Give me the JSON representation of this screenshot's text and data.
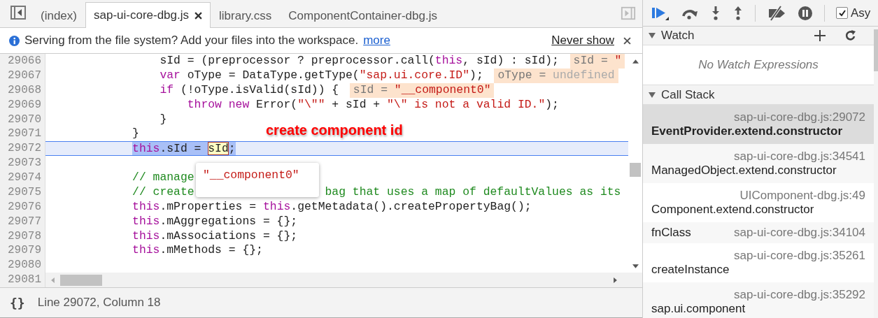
{
  "tabs": {
    "items": [
      {
        "label": "(index)",
        "selected": false,
        "closable": false
      },
      {
        "label": "sap-ui-core-dbg.js",
        "selected": true,
        "closable": true
      },
      {
        "label": "library.css",
        "selected": false,
        "closable": false
      },
      {
        "label": "ComponentContainer-dbg.js",
        "selected": false,
        "closable": false
      }
    ]
  },
  "infobar": {
    "message": "Serving from the file system? Add your files into the workspace.",
    "link": "more",
    "dismiss": "Never show"
  },
  "editor": {
    "lines": [
      {
        "number": "29066",
        "current": false,
        "tokens": [
          {
            "kind": "plain",
            "text": "                sId = (preprocessor ? preprocessor.call("
          },
          {
            "kind": "kw",
            "text": "this"
          },
          {
            "kind": "plain",
            "text": ", sId) : sId);"
          }
        ],
        "inline_value": [
          {
            "kind": "name",
            "text": "sId = "
          },
          {
            "kind": "str",
            "text": "\""
          }
        ]
      },
      {
        "number": "29067",
        "current": false,
        "tokens": [
          {
            "kind": "kw",
            "text": "                var"
          },
          {
            "kind": "plain",
            "text": " oType = DataType.getType("
          },
          {
            "kind": "str",
            "text": "\"sap.ui.core.ID\""
          },
          {
            "kind": "plain",
            "text": ");"
          }
        ],
        "inline_value": [
          {
            "kind": "name",
            "text": "oType = "
          },
          {
            "kind": "undef",
            "text": "undefined"
          }
        ]
      },
      {
        "number": "29068",
        "current": false,
        "tokens": [
          {
            "kind": "kw",
            "text": "                if"
          },
          {
            "kind": "plain",
            "text": " (!oType.isValid(sId)) {"
          }
        ],
        "inline_value": [
          {
            "kind": "name",
            "text": "sId = "
          },
          {
            "kind": "str",
            "text": "\"__component0\""
          }
        ]
      },
      {
        "number": "29069",
        "current": false,
        "tokens": [
          {
            "kind": "kw",
            "text": "                    throw new"
          },
          {
            "kind": "plain",
            "text": " Error("
          },
          {
            "kind": "str",
            "text": "\"\\\"\""
          },
          {
            "kind": "plain",
            "text": " + sId + "
          },
          {
            "kind": "str",
            "text": "\"\\\" is not a valid ID.\""
          },
          {
            "kind": "plain",
            "text": ");"
          }
        ]
      },
      {
        "number": "29070",
        "current": false,
        "tokens": [
          {
            "kind": "plain",
            "text": "                }"
          }
        ]
      },
      {
        "number": "29071",
        "current": false,
        "tokens": [
          {
            "kind": "plain",
            "text": "            }"
          }
        ]
      },
      {
        "number": "29072",
        "current": true,
        "selected": true,
        "tokens": [
          {
            "kind": "kw",
            "text": "            this"
          },
          {
            "kind": "plain",
            "text": ".sId = "
          },
          {
            "kind": "hover",
            "text": "sId"
          },
          {
            "kind": "plain",
            "text": ";"
          }
        ]
      },
      {
        "number": "29073",
        "current": false
      },
      {
        "number": "29074",
        "current": false,
        "tokens": [
          {
            "kind": "comment",
            "text": "            // manage"
          }
        ]
      },
      {
        "number": "29075",
        "current": false,
        "tokens": [
          {
            "kind": "comment",
            "text": "            // create"
          },
          {
            "kind": "hidden"
          },
          {
            "kind": "comment",
            "text": "bag that uses a map of defaultValues as its"
          }
        ]
      },
      {
        "number": "29076",
        "current": false,
        "tokens": [
          {
            "kind": "kw",
            "text": "            this"
          },
          {
            "kind": "plain",
            "text": ".mProperties = "
          },
          {
            "kind": "kw",
            "text": "this"
          },
          {
            "kind": "plain",
            "text": ".getMetadata().createPropertyBag();"
          }
        ]
      },
      {
        "number": "29077",
        "current": false,
        "tokens": [
          {
            "kind": "kw",
            "text": "            this"
          },
          {
            "kind": "plain",
            "text": ".mAggregations = {};"
          }
        ]
      },
      {
        "number": "29078",
        "current": false,
        "tokens": [
          {
            "kind": "kw",
            "text": "            this"
          },
          {
            "kind": "plain",
            "text": ".mAssociations = {};"
          }
        ]
      },
      {
        "number": "29079",
        "current": false,
        "tokens": [
          {
            "kind": "kw",
            "text": "            this"
          },
          {
            "kind": "plain",
            "text": ".mMethods = {};"
          }
        ]
      },
      {
        "number": "29080",
        "current": false
      },
      {
        "number": "29081"
      }
    ],
    "tooltip": "\"__component0\"",
    "annotation": "create component id"
  },
  "status_bar": {
    "format_button": "{}",
    "position": "Line 29072, Column 18"
  },
  "debugger": {
    "async_label": "Asy",
    "async_checked": true,
    "watch": {
      "title": "Watch",
      "expanded": true,
      "empty_text": "No Watch Expressions"
    },
    "call_stack": {
      "title": "Call Stack",
      "expanded": true,
      "frames": [
        {
          "kind": "stacked",
          "function": "EventProvider.extend.constructor",
          "file": "sap-ui-core-dbg.js:29072",
          "selected": true
        },
        {
          "kind": "stacked",
          "function": "ManagedObject.extend.constructor",
          "file": "sap-ui-core-dbg.js:34541",
          "selected": false
        },
        {
          "kind": "stacked",
          "function": "Component.extend.constructor",
          "file": "UIComponent-dbg.js:49",
          "selected": false
        },
        {
          "kind": "inline",
          "function": "fnClass",
          "file": "sap-ui-core-dbg.js:34104",
          "selected": false
        },
        {
          "kind": "stacked",
          "function": "createInstance",
          "file": "sap-ui-core-dbg.js:35261",
          "selected": false
        },
        {
          "kind": "stacked",
          "function": "sap.ui.component",
          "file": "sap-ui-core-dbg.js:35292",
          "selected": false
        }
      ]
    }
  }
}
